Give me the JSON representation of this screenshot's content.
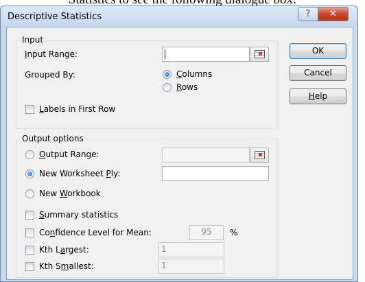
{
  "background_caption": "Statistics to see the following dialogue box:",
  "window": {
    "title": "Descriptive Statistics",
    "help_icon": "question-icon",
    "close_icon": "close-icon"
  },
  "input_group": {
    "title": "Input",
    "input_range_label_u": "I",
    "input_range_label_rest": "nput Range:",
    "input_range_value": "",
    "grouped_by_label": "Grouped By:",
    "columns_u": "C",
    "columns_rest": "olumns",
    "rows_u": "R",
    "rows_rest": "ows",
    "labels_u": "L",
    "labels_rest": "abels in First Row",
    "grouped_by_selected": "Columns"
  },
  "output_group": {
    "title": "Output options",
    "output_range_u": "O",
    "output_range_rest": "utput Range:",
    "nws_pre": "New Worksheet ",
    "nws_u": "P",
    "nws_post": "ly:",
    "nwb_pre": "New ",
    "nwb_u": "W",
    "nwb_post": "orkbook",
    "summary_u": "S",
    "summary_rest": "ummary statistics",
    "confidence_pre": "Co",
    "confidence_u": "n",
    "confidence_post": "fidence Level for Mean:",
    "confidence_value": "95",
    "confidence_unit": "%",
    "kth_largest_pre": "Kth L",
    "kth_largest_u": "a",
    "kth_largest_post": "rgest:",
    "kth_largest_value": "1",
    "kth_smallest_pre": "Kth S",
    "kth_smallest_u": "m",
    "kth_smallest_post": "allest:",
    "kth_smallest_value": "1",
    "selected_output": "New Worksheet Ply"
  },
  "buttons": {
    "ok": "OK",
    "cancel": "Cancel",
    "help_u": "H",
    "help_rest": "elp"
  }
}
